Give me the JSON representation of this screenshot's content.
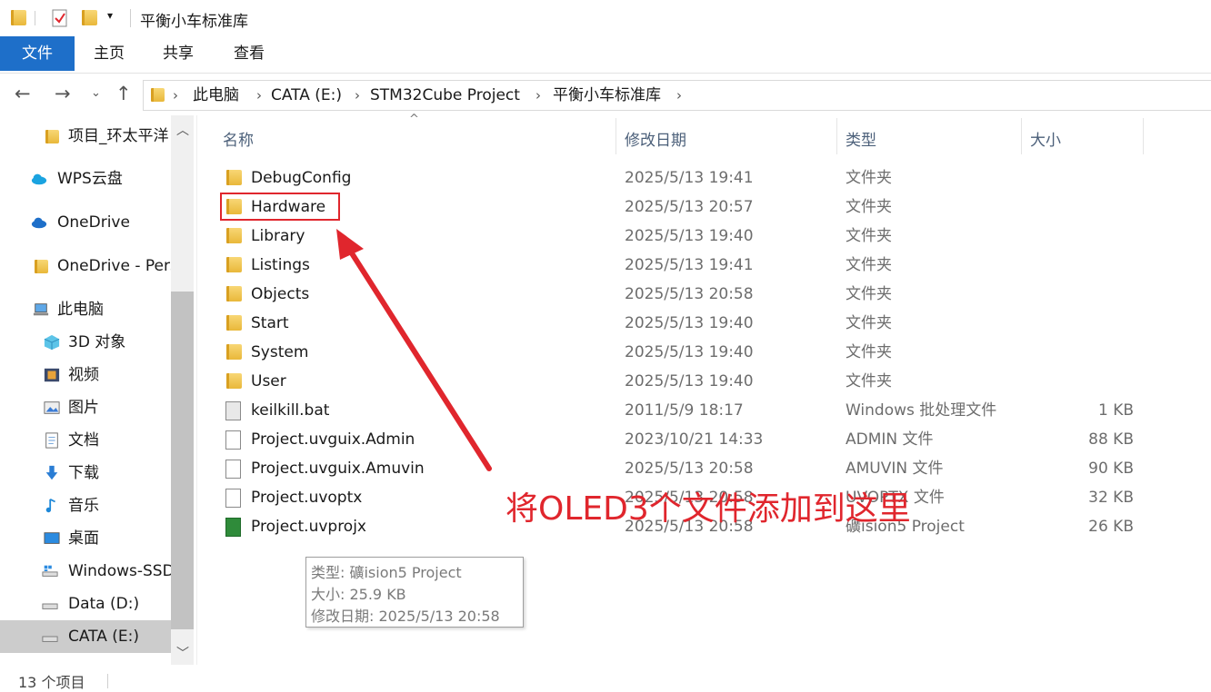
{
  "window": {
    "title": "平衡小车标准库"
  },
  "ribbon": {
    "tabs": [
      "文件",
      "主页",
      "共享",
      "查看"
    ]
  },
  "address": {
    "crumbs": [
      "此电脑",
      "CATA (E:)",
      "STM32Cube Project",
      "平衡小车标准库"
    ]
  },
  "sidebar": {
    "items": [
      {
        "label": "项目_环太平洋",
        "icon": "folder-icon"
      },
      {
        "label": "WPS云盘",
        "icon": "cloud-icon"
      },
      {
        "label": "OneDrive",
        "icon": "cloud-icon"
      },
      {
        "label": "OneDrive - Personal",
        "icon": "folder-icon"
      },
      {
        "label": "此电脑",
        "icon": "computer-icon"
      },
      {
        "label": "3D 对象",
        "icon": "cube-icon"
      },
      {
        "label": "视频",
        "icon": "video-icon"
      },
      {
        "label": "图片",
        "icon": "picture-icon"
      },
      {
        "label": "文档",
        "icon": "document-icon"
      },
      {
        "label": "下载",
        "icon": "download-icon"
      },
      {
        "label": "音乐",
        "icon": "music-icon"
      },
      {
        "label": "桌面",
        "icon": "desktop-icon"
      },
      {
        "label": "Windows-SSD",
        "icon": "drive-icon"
      },
      {
        "label": "Data (D:)",
        "icon": "drive-icon"
      },
      {
        "label": "CATA (E:)",
        "icon": "drive-icon"
      }
    ]
  },
  "columns": {
    "name": "名称",
    "date": "修改日期",
    "type": "类型",
    "size": "大小"
  },
  "files": [
    {
      "name": "DebugConfig",
      "date": "2025/5/13 19:41",
      "type": "文件夹",
      "size": "",
      "icon": "folder-icon"
    },
    {
      "name": "Hardware",
      "date": "2025/5/13 20:57",
      "type": "文件夹",
      "size": "",
      "icon": "folder-icon"
    },
    {
      "name": "Library",
      "date": "2025/5/13 19:40",
      "type": "文件夹",
      "size": "",
      "icon": "folder-icon"
    },
    {
      "name": "Listings",
      "date": "2025/5/13 19:41",
      "type": "文件夹",
      "size": "",
      "icon": "folder-icon"
    },
    {
      "name": "Objects",
      "date": "2025/5/13 20:58",
      "type": "文件夹",
      "size": "",
      "icon": "folder-icon"
    },
    {
      "name": "Start",
      "date": "2025/5/13 19:40",
      "type": "文件夹",
      "size": "",
      "icon": "folder-icon"
    },
    {
      "name": "System",
      "date": "2025/5/13 19:40",
      "type": "文件夹",
      "size": "",
      "icon": "folder-icon"
    },
    {
      "name": "User",
      "date": "2025/5/13 19:40",
      "type": "文件夹",
      "size": "",
      "icon": "folder-icon"
    },
    {
      "name": "keilkill.bat",
      "date": "2011/5/9 18:17",
      "type": "Windows 批处理文件",
      "size": "1 KB",
      "icon": "batch-file-icon"
    },
    {
      "name": "Project.uvguix.Admin",
      "date": "2023/10/21 14:33",
      "type": "ADMIN 文件",
      "size": "88 KB",
      "icon": "file-icon"
    },
    {
      "name": "Project.uvguix.Amuvin",
      "date": "2025/5/13 20:58",
      "type": "AMUVIN 文件",
      "size": "90 KB",
      "icon": "file-icon"
    },
    {
      "name": "Project.uvoptx",
      "date": "2025/5/13 20:58",
      "type": "UVOPTX 文件",
      "size": "32 KB",
      "icon": "file-icon"
    },
    {
      "name": "Project.uvprojx",
      "date": "2025/5/13 20:58",
      "type": "礦ision5 Project",
      "size": "26 KB",
      "icon": "keil-project-icon"
    }
  ],
  "status": {
    "item_count": "13 个项目"
  },
  "tooltip": {
    "type": "类型: 礦ision5 Project",
    "size": "大小: 25.9 KB",
    "date": "修改日期: 2025/5/13 20:58"
  },
  "annotation": {
    "note": "将OLED3个文件添加到这里",
    "color": "#e0262d"
  }
}
